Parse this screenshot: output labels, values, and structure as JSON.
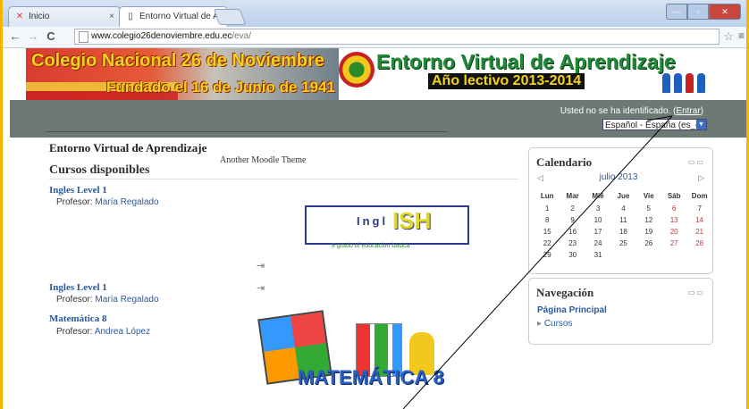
{
  "browser": {
    "tabs": [
      {
        "label": "Inicio",
        "icon": "moodle-icon"
      },
      {
        "label": "Entorno Virtual de Aprend",
        "icon": "page-icon"
      }
    ],
    "url_host": "www.colegio26denoviembre.edu.ec",
    "url_path": "/eva/"
  },
  "banner": {
    "title_left": "Colegio Nacional 26 de Noviembre",
    "subtitle_left": "Fundado el 16 de Junio de 1941",
    "title_right": "Entorno Virtual de Aprendizaje",
    "subtitle_right": "Año lectivo 2013-2014"
  },
  "login": {
    "text": "Usted no se ha identificado.",
    "link": "Entrar",
    "language": "Español - España (es_es)"
  },
  "main": {
    "site_name": "Entorno Virtual de Aprendizaje",
    "theme": "Another Moodle Theme",
    "courses_heading": "Cursos disponibles",
    "courses": [
      {
        "name": "Ingles Level 1",
        "prof_label": "Profesor:",
        "prof": "María Regalado"
      },
      {
        "name": "Ingles Level 1",
        "prof_label": "Profesor:",
        "prof": "María Regalado"
      },
      {
        "name": "Matemática 8",
        "prof_label": "Profesor:",
        "prof": "Andrea López"
      }
    ],
    "english_img": {
      "t1": "Ingl",
      "t2": "ISH",
      "sub": "9 grado of educacion basica"
    },
    "math_img": {
      "text": "MATEMÁTICA 8"
    }
  },
  "calendar": {
    "title": "Calendario",
    "month": "julio 2013",
    "days": [
      "Lun",
      "Mar",
      "Mié",
      "Jue",
      "Vie",
      "Sáb",
      "Dom"
    ],
    "weeks": [
      [
        "1",
        "2",
        "3",
        "4",
        "5",
        "6",
        "7"
      ],
      [
        "8",
        "9",
        "10",
        "11",
        "12",
        "13",
        "14"
      ],
      [
        "15",
        "16",
        "17",
        "18",
        "19",
        "20",
        "21"
      ],
      [
        "22",
        "23",
        "24",
        "25",
        "26",
        "27",
        "28"
      ],
      [
        "29",
        "30",
        "31",
        "",
        "",
        "",
        ""
      ]
    ]
  },
  "navigation": {
    "title": "Navegación",
    "main_link": "Página Principal",
    "courses_link": "Cursos"
  }
}
